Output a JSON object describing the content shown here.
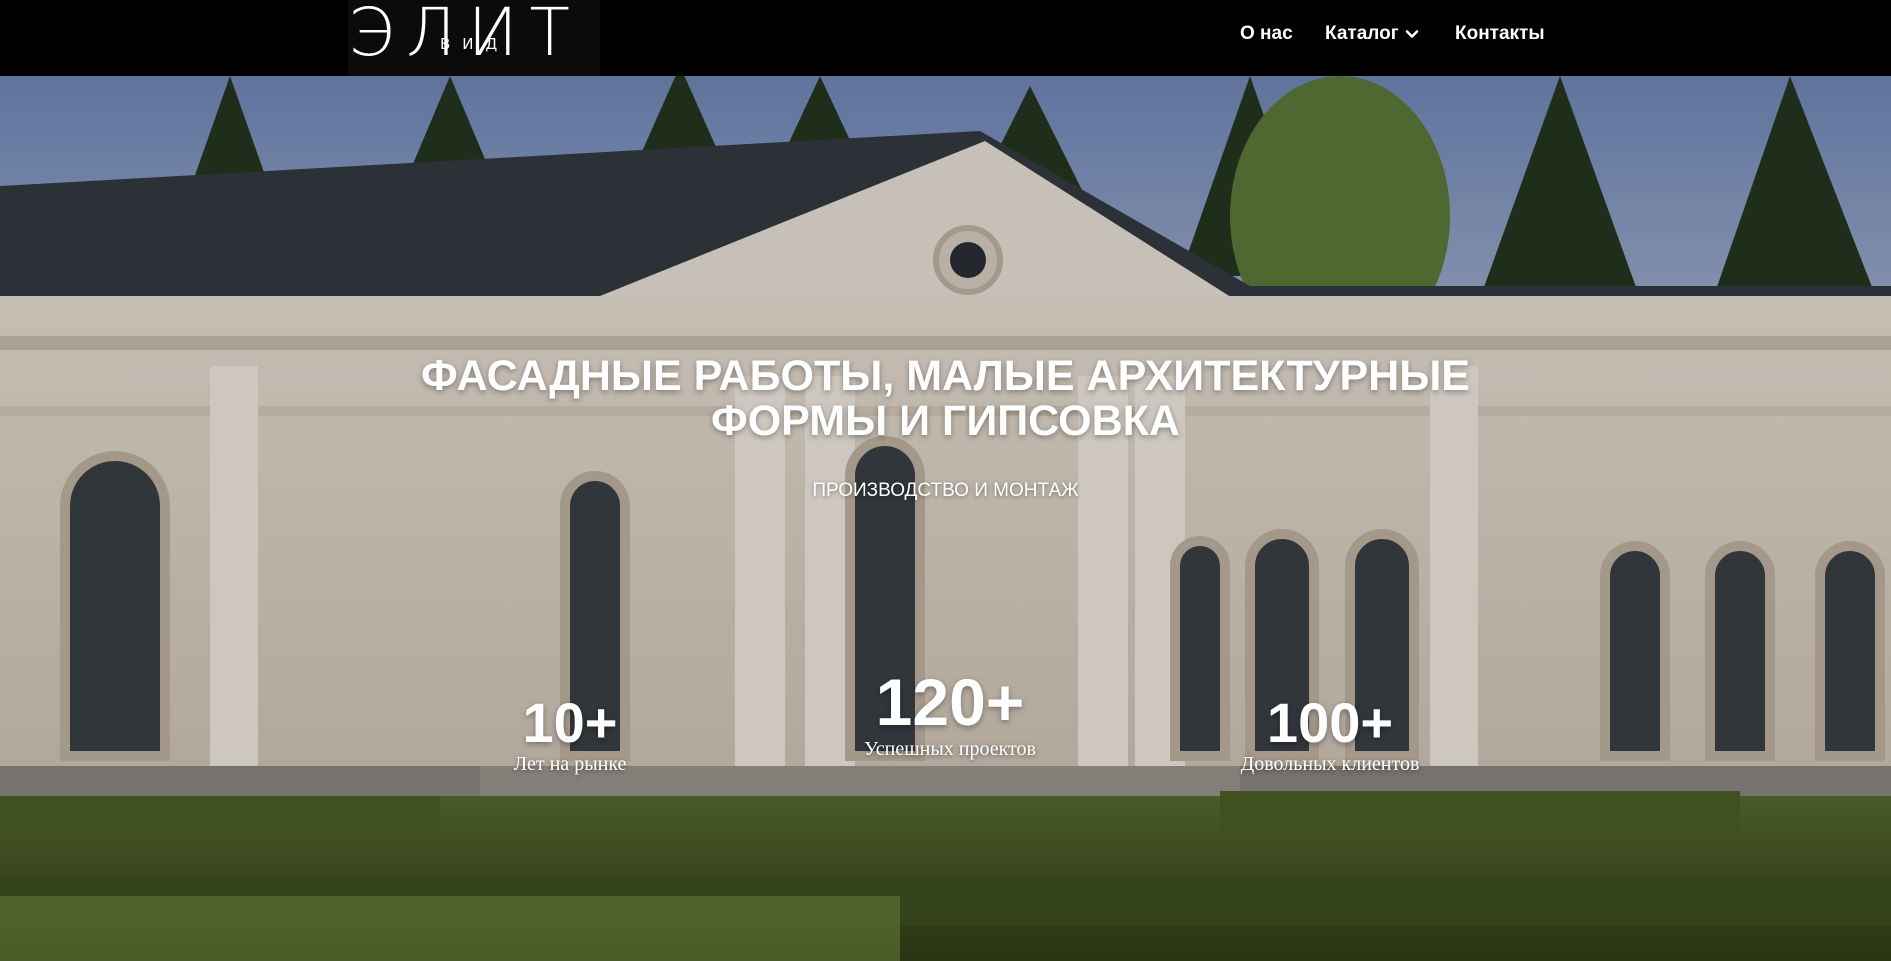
{
  "header": {
    "logo_text": "ЭЛИТ",
    "logo_sub": "ВИД",
    "nav": [
      {
        "label": "О нас"
      },
      {
        "label": "Каталог",
        "icon": "chevron-down-icon"
      },
      {
        "label": "Контакты"
      }
    ]
  },
  "hero": {
    "title_line1": "ФАСАДНЫЕ РАБОТЫ, МАЛЫЕ АРХИТЕКТУРНЫЕ",
    "title_line2": "ФОРМЫ И ГИПСОВКА",
    "subtitle": "ПРОИЗВОДСТВО И МОНТАЖ",
    "stats": [
      {
        "value": "10+",
        "label": "Лет на рынке"
      },
      {
        "value": "120+",
        "label": "Успешных проектов"
      },
      {
        "value": "100+",
        "label": "Довольных клиентов"
      }
    ]
  },
  "colors": {
    "header_bg": "#000000",
    "text": "#ffffff",
    "sky": "#8fa6cf",
    "facade": "#ddd2c5",
    "hedge": "#4a5a2a"
  }
}
